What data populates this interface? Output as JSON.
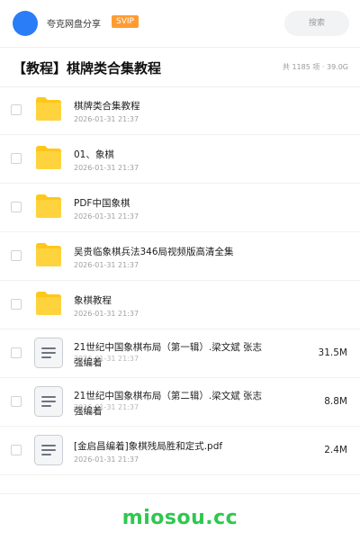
{
  "header": {
    "share_name": "夸克网盘分享",
    "badge": "SVIP",
    "search_placeholder": "搜索"
  },
  "title": {
    "text": "【教程】棋牌类合集教程",
    "summary": "共 1185 项 · 39.0G"
  },
  "items": [
    {
      "type": "folder",
      "name": "棋牌类合集教程",
      "date": "2026-01-31 21:37",
      "size": ""
    },
    {
      "type": "folder",
      "name": "01、象棋",
      "date": "2026-01-31 21:37",
      "size": ""
    },
    {
      "type": "folder",
      "name": "PDF中国象棋",
      "date": "2026-01-31 21:37",
      "size": ""
    },
    {
      "type": "folder",
      "name": "吴贵临象棋兵法346局视频版高清全集",
      "date": "2026-01-31 21:37",
      "size": ""
    },
    {
      "type": "folder",
      "name": "象棋教程",
      "date": "2026-01-31 21:37",
      "size": ""
    },
    {
      "type": "file",
      "name": "21世纪中国象棋布局（第一辑）.梁文斌 张志强编着",
      "date": "2026-01-31 21:37",
      "size": "31.5M"
    },
    {
      "type": "file",
      "name": "21世纪中国象棋布局（第二辑）.梁文斌 张志强编着",
      "date": "2026-01-31 21:37",
      "size": "8.8M"
    },
    {
      "type": "file",
      "name": "[金启昌编着]象棋残局胜和定式.pdf",
      "date": "2026-01-31 21:37",
      "size": "2.4M"
    }
  ],
  "footer": {
    "watermark": "miosou.cc"
  },
  "colors": {
    "avatar": "#2b7cf7",
    "badge": "#ff9c33",
    "folder": "#ffc71a",
    "watermark": "#2ec74f"
  },
  "icons": {
    "folder": "folder-icon",
    "file": "document-icon"
  }
}
